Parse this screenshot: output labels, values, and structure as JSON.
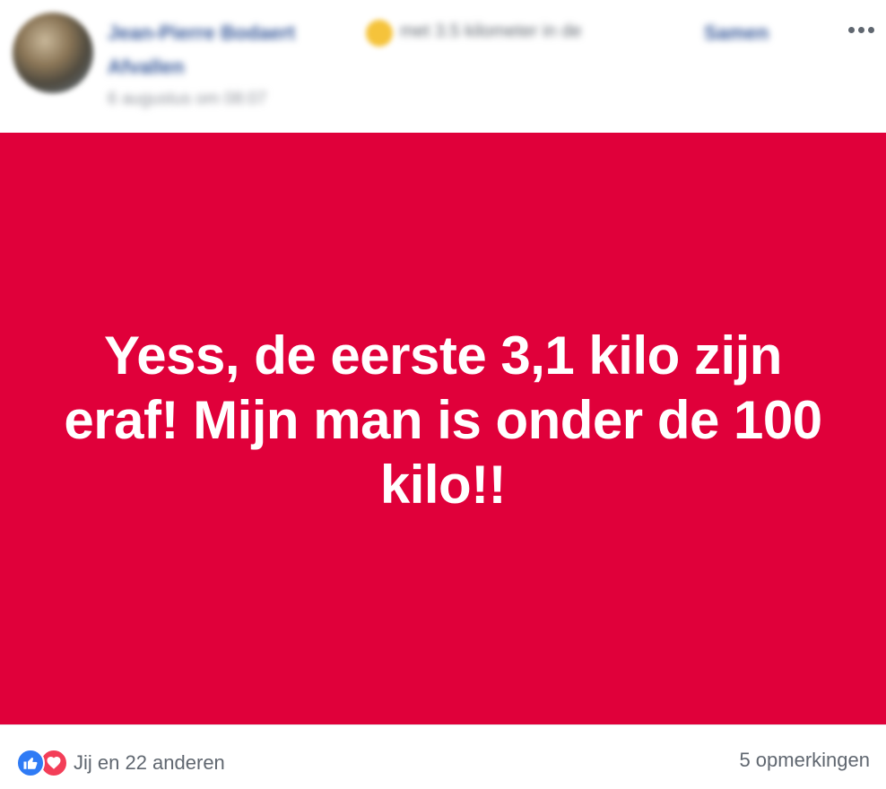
{
  "header": {
    "author_name": "Jean-Pierre Bodaert",
    "author_action": "met 3.5 kilometer in de",
    "group_name_part1": "Samen",
    "group_name_part2": "Afvallen",
    "timestamp": "6 augustus om 08:07"
  },
  "post": {
    "text": "Yess, de eerste 3,1 kilo zijn eraf! Mijn man is onder de 100 kilo!!",
    "background_color": "#e0003a"
  },
  "footer": {
    "reactions_text": "Jij en 22 anderen",
    "comments_text": "5 opmerkingen",
    "reaction_icons": [
      "like-icon",
      "love-icon"
    ]
  }
}
